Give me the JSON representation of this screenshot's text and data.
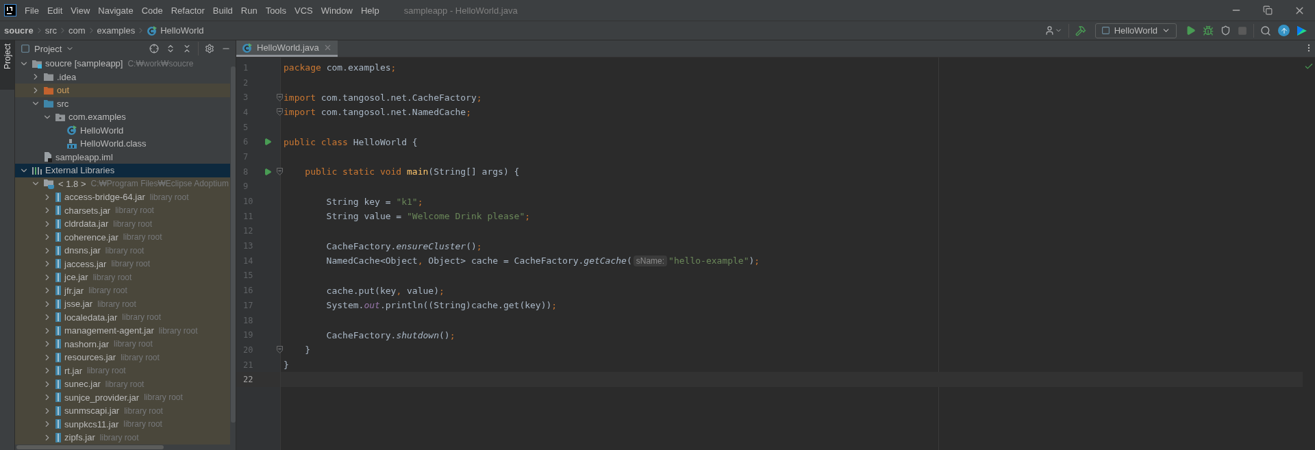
{
  "window": {
    "title": "sampleapp - HelloWorld.java"
  },
  "menu": [
    "File",
    "Edit",
    "View",
    "Navigate",
    "Code",
    "Refactor",
    "Build",
    "Run",
    "Tools",
    "VCS",
    "Window",
    "Help"
  ],
  "breadcrumb": [
    {
      "label": "soucre",
      "kind": "root"
    },
    {
      "label": "src",
      "kind": "folder"
    },
    {
      "label": "com",
      "kind": "folder"
    },
    {
      "label": "examples",
      "kind": "folder"
    },
    {
      "label": "HelloWorld",
      "kind": "class"
    }
  ],
  "toolbar": {
    "run_configuration": "HelloWorld"
  },
  "project_panel": {
    "side_tab": "Project",
    "title": "Project",
    "tree": [
      {
        "label": "soucre [sampleapp]",
        "hint": "C:₩work₩soucre",
        "kind": "module",
        "expanded": true,
        "selected": false,
        "children": [
          {
            "label": ".idea",
            "kind": "folder",
            "expanded": false,
            "selected": false
          },
          {
            "label": "out",
            "kind": "excluded-folder",
            "expanded": false,
            "selected": false
          },
          {
            "label": "src",
            "kind": "source-folder",
            "expanded": true,
            "selected": false,
            "children": [
              {
                "label": "com.examples",
                "kind": "package",
                "expanded": true,
                "selected": false,
                "children": [
                  {
                    "label": "HelloWorld",
                    "kind": "class",
                    "selected": false
                  },
                  {
                    "label": "HelloWorld.class",
                    "kind": "class-file",
                    "selected": false
                  }
                ]
              }
            ]
          },
          {
            "label": "sampleapp.iml",
            "kind": "module-file",
            "selected": false
          }
        ]
      },
      {
        "label": "External Libraries",
        "kind": "libraries",
        "expanded": true,
        "selected": true,
        "children": [
          {
            "label": "< 1.8 >",
            "hint": "C:₩Program Files₩Eclipse Adoptium",
            "kind": "jdk",
            "expanded": true,
            "selected": false,
            "children": [
              {
                "label": "access-bridge-64.jar",
                "hint": "library root",
                "kind": "jar",
                "expanded": false,
                "selected": false
              },
              {
                "label": "charsets.jar",
                "hint": "library root",
                "kind": "jar",
                "expanded": false,
                "selected": false
              },
              {
                "label": "cldrdata.jar",
                "hint": "library root",
                "kind": "jar",
                "expanded": false,
                "selected": false
              },
              {
                "label": "coherence.jar",
                "hint": "library root",
                "kind": "jar",
                "expanded": false,
                "selected": false
              },
              {
                "label": "dnsns.jar",
                "hint": "library root",
                "kind": "jar",
                "expanded": false,
                "selected": false
              },
              {
                "label": "jaccess.jar",
                "hint": "library root",
                "kind": "jar",
                "expanded": false,
                "selected": false
              },
              {
                "label": "jce.jar",
                "hint": "library root",
                "kind": "jar",
                "expanded": false,
                "selected": false
              },
              {
                "label": "jfr.jar",
                "hint": "library root",
                "kind": "jar",
                "expanded": false,
                "selected": false
              },
              {
                "label": "jsse.jar",
                "hint": "library root",
                "kind": "jar",
                "expanded": false,
                "selected": false
              },
              {
                "label": "localedata.jar",
                "hint": "library root",
                "kind": "jar",
                "expanded": false,
                "selected": false
              },
              {
                "label": "management-agent.jar",
                "hint": "library root",
                "kind": "jar",
                "expanded": false,
                "selected": false
              },
              {
                "label": "nashorn.jar",
                "hint": "library root",
                "kind": "jar",
                "expanded": false,
                "selected": false
              },
              {
                "label": "resources.jar",
                "hint": "library root",
                "kind": "jar",
                "expanded": false,
                "selected": false
              },
              {
                "label": "rt.jar",
                "hint": "library root",
                "kind": "jar",
                "expanded": false,
                "selected": false
              },
              {
                "label": "sunec.jar",
                "hint": "library root",
                "kind": "jar",
                "expanded": false,
                "selected": false
              },
              {
                "label": "sunjce_provider.jar",
                "hint": "library root",
                "kind": "jar",
                "expanded": false,
                "selected": false
              },
              {
                "label": "sunmscapi.jar",
                "hint": "library root",
                "kind": "jar",
                "expanded": false,
                "selected": false
              },
              {
                "label": "sunpkcs11.jar",
                "hint": "library root",
                "kind": "jar",
                "expanded": false,
                "selected": false
              },
              {
                "label": "zipfs.jar",
                "hint": "library root",
                "kind": "jar",
                "expanded": false,
                "selected": false
              }
            ]
          }
        ]
      }
    ]
  },
  "editor": {
    "tabs": [
      {
        "label": "HelloWorld.java",
        "selected": true
      }
    ],
    "lines": [
      {
        "number": "1",
        "tokens": [
          {
            "kind": "keyword",
            "text": "package "
          },
          {
            "kind": "plain",
            "text": "com.examples"
          },
          {
            "kind": "punct",
            "text": ";"
          }
        ]
      },
      {
        "number": "2"
      },
      {
        "number": "3",
        "fold": true,
        "tokens": [
          {
            "kind": "keyword",
            "text": "import "
          },
          {
            "kind": "plain",
            "text": "com.tangosol.net.CacheFactory"
          },
          {
            "kind": "punct",
            "text": ";"
          }
        ]
      },
      {
        "number": "4",
        "fold": true,
        "tokens": [
          {
            "kind": "keyword",
            "text": "import "
          },
          {
            "kind": "plain",
            "text": "com.tangosol.net.NamedCache"
          },
          {
            "kind": "punct",
            "text": ";"
          }
        ]
      },
      {
        "number": "5"
      },
      {
        "number": "6",
        "run": true,
        "tokens": [
          {
            "kind": "keyword",
            "text": "public class "
          },
          {
            "kind": "plain",
            "text": "HelloWorld {"
          }
        ]
      },
      {
        "number": "7"
      },
      {
        "number": "8",
        "run": true,
        "fold": true,
        "tokens": [
          {
            "kind": "keyword",
            "text": "    public static void "
          },
          {
            "kind": "method",
            "text": "main"
          },
          {
            "kind": "plain",
            "text": "(String[] args) {"
          }
        ]
      },
      {
        "number": "9"
      },
      {
        "number": "10",
        "tokens": [
          {
            "kind": "plain",
            "text": "        String key = "
          },
          {
            "kind": "string",
            "text": "\"k1\""
          },
          {
            "kind": "punct",
            "text": ";"
          }
        ]
      },
      {
        "number": "11",
        "tokens": [
          {
            "kind": "plain",
            "text": "        String value = "
          },
          {
            "kind": "string",
            "text": "\"Welcome Drink please\""
          },
          {
            "kind": "punct",
            "text": ";"
          }
        ]
      },
      {
        "number": "12"
      },
      {
        "number": "13",
        "tokens": [
          {
            "kind": "plain",
            "text": "        CacheFactory."
          },
          {
            "kind": "static-call",
            "text": "ensureCluster"
          },
          {
            "kind": "plain",
            "text": "()"
          },
          {
            "kind": "punct",
            "text": ";"
          }
        ]
      },
      {
        "number": "14",
        "tokens": [
          {
            "kind": "plain",
            "text": "        NamedCache<Object"
          },
          {
            "kind": "punct",
            "text": ", "
          },
          {
            "kind": "plain",
            "text": "Object> cache = CacheFactory."
          },
          {
            "kind": "static-call",
            "text": "getCache"
          },
          {
            "kind": "plain",
            "text": "("
          },
          {
            "kind": "hint",
            "text": "sName:"
          },
          {
            "kind": "string",
            "text": "\"hello-example\""
          },
          {
            "kind": "plain",
            "text": ")"
          },
          {
            "kind": "punct",
            "text": ";"
          }
        ]
      },
      {
        "number": "15"
      },
      {
        "number": "16",
        "tokens": [
          {
            "kind": "plain",
            "text": "        cache.put(key"
          },
          {
            "kind": "punct",
            "text": ", "
          },
          {
            "kind": "plain",
            "text": "value)"
          },
          {
            "kind": "punct",
            "text": ";"
          }
        ]
      },
      {
        "number": "17",
        "tokens": [
          {
            "kind": "plain",
            "text": "        System."
          },
          {
            "kind": "static-field",
            "text": "out"
          },
          {
            "kind": "plain",
            "text": ".println((String)cache.get(key))"
          },
          {
            "kind": "punct",
            "text": ";"
          }
        ]
      },
      {
        "number": "18"
      },
      {
        "number": "19",
        "tokens": [
          {
            "kind": "plain",
            "text": "        CacheFactory."
          },
          {
            "kind": "static-call",
            "text": "shutdown"
          },
          {
            "kind": "plain",
            "text": "()"
          },
          {
            "kind": "punct",
            "text": ";"
          }
        ]
      },
      {
        "number": "20",
        "fold": true,
        "tokens": [
          {
            "kind": "plain",
            "text": "    }"
          }
        ]
      },
      {
        "number": "21",
        "tokens": [
          {
            "kind": "plain",
            "text": "}"
          }
        ]
      },
      {
        "number": "22",
        "current": true
      }
    ]
  }
}
